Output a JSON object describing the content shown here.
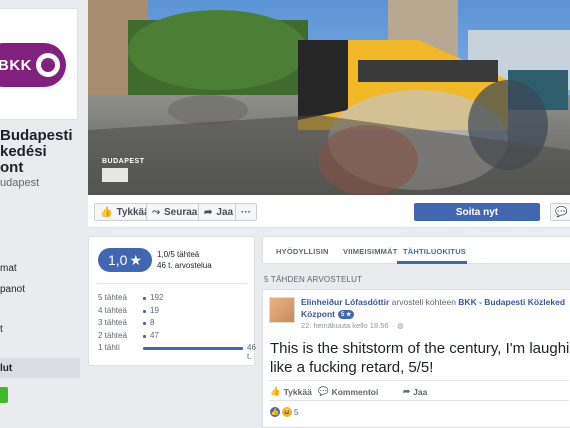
{
  "sidebar": {
    "logo_text": "BKK",
    "title_lines": [
      "Budapesti",
      "kedési",
      "ont"
    ],
    "handle": "udapest",
    "nav_items": [
      "mat",
      "panot",
      "t"
    ],
    "active_item": "lut",
    "logo_color": "#82207e"
  },
  "cover": {
    "credit": "BUDAPEST"
  },
  "actions": {
    "like": "Tykkää",
    "follow": "Seuraa",
    "share": "Jaa",
    "more": "···",
    "send": "Soita nyt",
    "message_icon": "messenger-icon"
  },
  "rating": {
    "value": "1,0",
    "star": "★",
    "main_text": "1,0/5 tähteä",
    "count_text": "46 t. arvostelua",
    "rows": [
      {
        "label": "5 tähteä",
        "count": "192",
        "fraction": 0
      },
      {
        "label": "4 tähteä",
        "count": "19",
        "fraction": 0
      },
      {
        "label": "3 tähteä",
        "count": "8",
        "fraction": 0
      },
      {
        "label": "2 tähteä",
        "count": "47",
        "fraction": 0
      },
      {
        "label": "1 tähti",
        "count": "46 t.",
        "fraction": 1
      }
    ]
  },
  "tabs": [
    "HYÖDYLLISIN",
    "VIIMEISIMMÄT",
    "TÄHTILUOKITUS"
  ],
  "active_tab": "TÄHTILUOKITUS",
  "section_heading": "5 TÄHDEN ARVOSTELUT",
  "review": {
    "author": "Elinheiður Lófasdóttir",
    "verb": " arvosteli kohteen ",
    "page": "BKK - Budapesti Közleked",
    "page_cont": "Központ",
    "stars_badge": "5 ★",
    "date": "22. heinäkuuta kello 18.56",
    "dot": "·",
    "text": "This is the shitstorm of the century, I'm laughi like a fucking retard, 5/5!",
    "like": "Tykkää",
    "comment": "Kommentoi",
    "share": "Jaa",
    "reaction_count": "5"
  }
}
